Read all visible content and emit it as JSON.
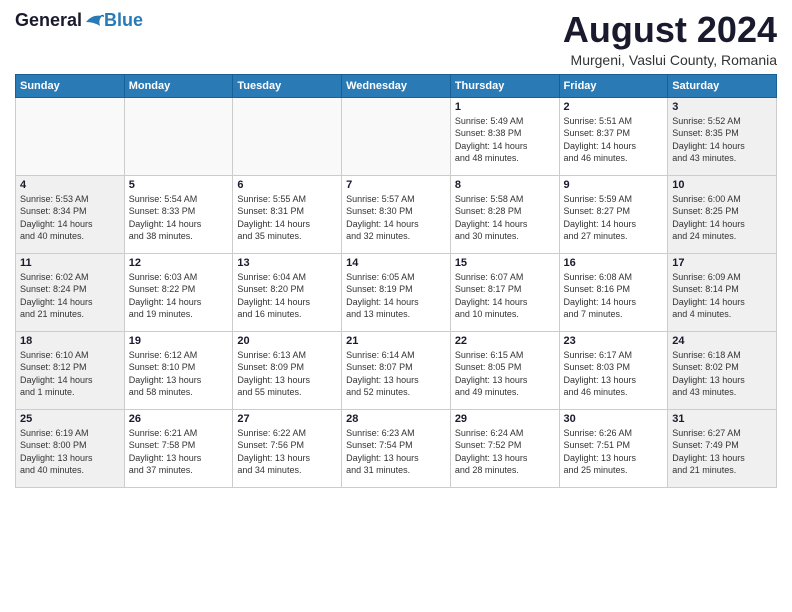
{
  "logo": {
    "general": "General",
    "blue": "Blue"
  },
  "title": "August 2024",
  "subtitle": "Murgeni, Vaslui County, Romania",
  "weekdays": [
    "Sunday",
    "Monday",
    "Tuesday",
    "Wednesday",
    "Thursday",
    "Friday",
    "Saturday"
  ],
  "weeks": [
    [
      {
        "day": "",
        "info": ""
      },
      {
        "day": "",
        "info": ""
      },
      {
        "day": "",
        "info": ""
      },
      {
        "day": "",
        "info": ""
      },
      {
        "day": "1",
        "info": "Sunrise: 5:49 AM\nSunset: 8:38 PM\nDaylight: 14 hours\nand 48 minutes."
      },
      {
        "day": "2",
        "info": "Sunrise: 5:51 AM\nSunset: 8:37 PM\nDaylight: 14 hours\nand 46 minutes."
      },
      {
        "day": "3",
        "info": "Sunrise: 5:52 AM\nSunset: 8:35 PM\nDaylight: 14 hours\nand 43 minutes."
      }
    ],
    [
      {
        "day": "4",
        "info": "Sunrise: 5:53 AM\nSunset: 8:34 PM\nDaylight: 14 hours\nand 40 minutes."
      },
      {
        "day": "5",
        "info": "Sunrise: 5:54 AM\nSunset: 8:33 PM\nDaylight: 14 hours\nand 38 minutes."
      },
      {
        "day": "6",
        "info": "Sunrise: 5:55 AM\nSunset: 8:31 PM\nDaylight: 14 hours\nand 35 minutes."
      },
      {
        "day": "7",
        "info": "Sunrise: 5:57 AM\nSunset: 8:30 PM\nDaylight: 14 hours\nand 32 minutes."
      },
      {
        "day": "8",
        "info": "Sunrise: 5:58 AM\nSunset: 8:28 PM\nDaylight: 14 hours\nand 30 minutes."
      },
      {
        "day": "9",
        "info": "Sunrise: 5:59 AM\nSunset: 8:27 PM\nDaylight: 14 hours\nand 27 minutes."
      },
      {
        "day": "10",
        "info": "Sunrise: 6:00 AM\nSunset: 8:25 PM\nDaylight: 14 hours\nand 24 minutes."
      }
    ],
    [
      {
        "day": "11",
        "info": "Sunrise: 6:02 AM\nSunset: 8:24 PM\nDaylight: 14 hours\nand 21 minutes."
      },
      {
        "day": "12",
        "info": "Sunrise: 6:03 AM\nSunset: 8:22 PM\nDaylight: 14 hours\nand 19 minutes."
      },
      {
        "day": "13",
        "info": "Sunrise: 6:04 AM\nSunset: 8:20 PM\nDaylight: 14 hours\nand 16 minutes."
      },
      {
        "day": "14",
        "info": "Sunrise: 6:05 AM\nSunset: 8:19 PM\nDaylight: 14 hours\nand 13 minutes."
      },
      {
        "day": "15",
        "info": "Sunrise: 6:07 AM\nSunset: 8:17 PM\nDaylight: 14 hours\nand 10 minutes."
      },
      {
        "day": "16",
        "info": "Sunrise: 6:08 AM\nSunset: 8:16 PM\nDaylight: 14 hours\nand 7 minutes."
      },
      {
        "day": "17",
        "info": "Sunrise: 6:09 AM\nSunset: 8:14 PM\nDaylight: 14 hours\nand 4 minutes."
      }
    ],
    [
      {
        "day": "18",
        "info": "Sunrise: 6:10 AM\nSunset: 8:12 PM\nDaylight: 14 hours\nand 1 minute."
      },
      {
        "day": "19",
        "info": "Sunrise: 6:12 AM\nSunset: 8:10 PM\nDaylight: 13 hours\nand 58 minutes."
      },
      {
        "day": "20",
        "info": "Sunrise: 6:13 AM\nSunset: 8:09 PM\nDaylight: 13 hours\nand 55 minutes."
      },
      {
        "day": "21",
        "info": "Sunrise: 6:14 AM\nSunset: 8:07 PM\nDaylight: 13 hours\nand 52 minutes."
      },
      {
        "day": "22",
        "info": "Sunrise: 6:15 AM\nSunset: 8:05 PM\nDaylight: 13 hours\nand 49 minutes."
      },
      {
        "day": "23",
        "info": "Sunrise: 6:17 AM\nSunset: 8:03 PM\nDaylight: 13 hours\nand 46 minutes."
      },
      {
        "day": "24",
        "info": "Sunrise: 6:18 AM\nSunset: 8:02 PM\nDaylight: 13 hours\nand 43 minutes."
      }
    ],
    [
      {
        "day": "25",
        "info": "Sunrise: 6:19 AM\nSunset: 8:00 PM\nDaylight: 13 hours\nand 40 minutes."
      },
      {
        "day": "26",
        "info": "Sunrise: 6:21 AM\nSunset: 7:58 PM\nDaylight: 13 hours\nand 37 minutes."
      },
      {
        "day": "27",
        "info": "Sunrise: 6:22 AM\nSunset: 7:56 PM\nDaylight: 13 hours\nand 34 minutes."
      },
      {
        "day": "28",
        "info": "Sunrise: 6:23 AM\nSunset: 7:54 PM\nDaylight: 13 hours\nand 31 minutes."
      },
      {
        "day": "29",
        "info": "Sunrise: 6:24 AM\nSunset: 7:52 PM\nDaylight: 13 hours\nand 28 minutes."
      },
      {
        "day": "30",
        "info": "Sunrise: 6:26 AM\nSunset: 7:51 PM\nDaylight: 13 hours\nand 25 minutes."
      },
      {
        "day": "31",
        "info": "Sunrise: 6:27 AM\nSunset: 7:49 PM\nDaylight: 13 hours\nand 21 minutes."
      }
    ]
  ]
}
